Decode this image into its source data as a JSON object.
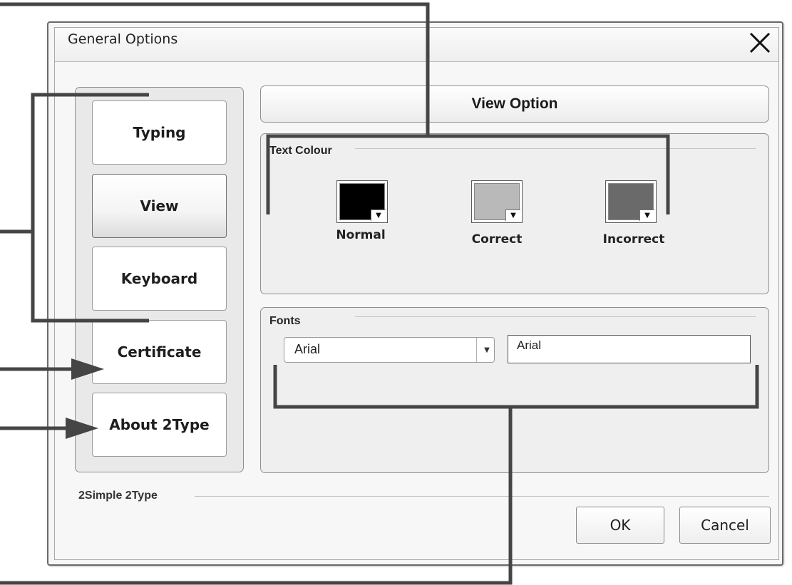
{
  "window": {
    "title": "General Options"
  },
  "sidebar": {
    "items": [
      {
        "label": "Typing",
        "active": false
      },
      {
        "label": "View",
        "active": true
      },
      {
        "label": "Keyboard",
        "active": false
      },
      {
        "label": "Certificate",
        "active": false
      },
      {
        "label": "About 2Type",
        "active": false
      }
    ]
  },
  "main": {
    "header": "View Option",
    "text_colour": {
      "title": "Text Colour",
      "swatches": [
        {
          "label": "Normal",
          "color": "#000000"
        },
        {
          "label": "Correct",
          "color": "#b9b9b9"
        },
        {
          "label": "Incorrect",
          "color": "#6a6a6a"
        }
      ]
    },
    "fonts": {
      "title": "Fonts",
      "selected_font": "Arial",
      "preview_text": "Arial"
    }
  },
  "footer": {
    "brand": "2Simple  2Type",
    "ok_label": "OK",
    "cancel_label": "Cancel"
  },
  "icons": {
    "close": "close-icon",
    "dropdown": "chevron-down-icon"
  },
  "colors": {
    "callout_line": "#454545"
  }
}
